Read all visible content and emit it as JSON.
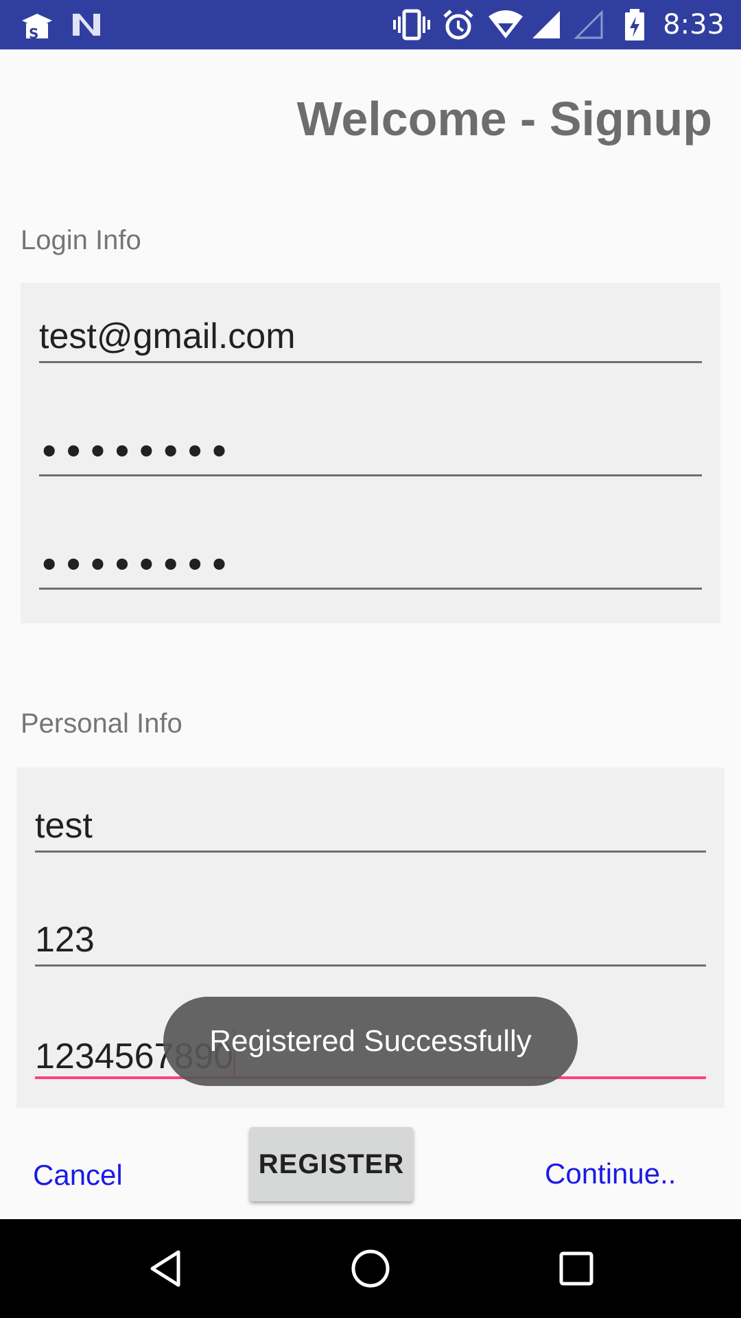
{
  "status_bar": {
    "time": "8:33",
    "color": "#303f9f",
    "icons": [
      "app-notification-icon",
      "n-notification-icon",
      "vibrate-icon",
      "alarm-icon",
      "wifi-icon",
      "cell-signal-icon",
      "cell-signal-empty-icon",
      "battery-charging-icon"
    ]
  },
  "header": {
    "title": "Welcome - Signup"
  },
  "login_info": {
    "label": "Login Info",
    "email_value": "test@gmail.com",
    "password_value": "••••••••",
    "confirm_password_value": "••••••••"
  },
  "personal_info": {
    "label": "Personal Info",
    "name_value": "test",
    "age_value": "123",
    "phone_value": "1234567890"
  },
  "actions": {
    "cancel_label": "Cancel",
    "register_label": "REGISTER",
    "continue_label": "Continue..",
    "link_color": "#1a1ae6"
  },
  "toast": {
    "message": "Registered Successfully"
  },
  "nav_bar": {
    "icons": [
      "back-icon",
      "home-icon",
      "recents-icon"
    ]
  },
  "colors": {
    "accent": "#ff4081",
    "panel": "#f0f0f0",
    "background": "#fafafa"
  }
}
